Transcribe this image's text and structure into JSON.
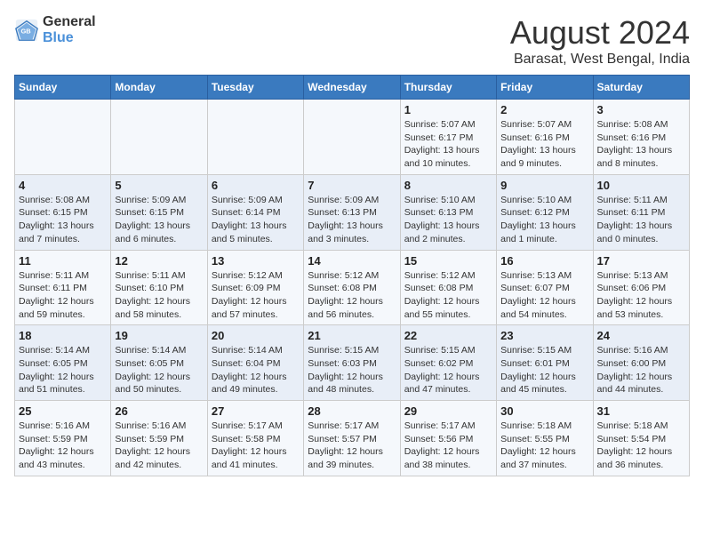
{
  "logo": {
    "line1": "General",
    "line2": "Blue"
  },
  "title": "August 2024",
  "subtitle": "Barasat, West Bengal, India",
  "days_of_week": [
    "Sunday",
    "Monday",
    "Tuesday",
    "Wednesday",
    "Thursday",
    "Friday",
    "Saturday"
  ],
  "weeks": [
    [
      {
        "day": "",
        "info": ""
      },
      {
        "day": "",
        "info": ""
      },
      {
        "day": "",
        "info": ""
      },
      {
        "day": "",
        "info": ""
      },
      {
        "day": "1",
        "info": "Sunrise: 5:07 AM\nSunset: 6:17 PM\nDaylight: 13 hours\nand 10 minutes."
      },
      {
        "day": "2",
        "info": "Sunrise: 5:07 AM\nSunset: 6:16 PM\nDaylight: 13 hours\nand 9 minutes."
      },
      {
        "day": "3",
        "info": "Sunrise: 5:08 AM\nSunset: 6:16 PM\nDaylight: 13 hours\nand 8 minutes."
      }
    ],
    [
      {
        "day": "4",
        "info": "Sunrise: 5:08 AM\nSunset: 6:15 PM\nDaylight: 13 hours\nand 7 minutes."
      },
      {
        "day": "5",
        "info": "Sunrise: 5:09 AM\nSunset: 6:15 PM\nDaylight: 13 hours\nand 6 minutes."
      },
      {
        "day": "6",
        "info": "Sunrise: 5:09 AM\nSunset: 6:14 PM\nDaylight: 13 hours\nand 5 minutes."
      },
      {
        "day": "7",
        "info": "Sunrise: 5:09 AM\nSunset: 6:13 PM\nDaylight: 13 hours\nand 3 minutes."
      },
      {
        "day": "8",
        "info": "Sunrise: 5:10 AM\nSunset: 6:13 PM\nDaylight: 13 hours\nand 2 minutes."
      },
      {
        "day": "9",
        "info": "Sunrise: 5:10 AM\nSunset: 6:12 PM\nDaylight: 13 hours\nand 1 minute."
      },
      {
        "day": "10",
        "info": "Sunrise: 5:11 AM\nSunset: 6:11 PM\nDaylight: 13 hours\nand 0 minutes."
      }
    ],
    [
      {
        "day": "11",
        "info": "Sunrise: 5:11 AM\nSunset: 6:11 PM\nDaylight: 12 hours\nand 59 minutes."
      },
      {
        "day": "12",
        "info": "Sunrise: 5:11 AM\nSunset: 6:10 PM\nDaylight: 12 hours\nand 58 minutes."
      },
      {
        "day": "13",
        "info": "Sunrise: 5:12 AM\nSunset: 6:09 PM\nDaylight: 12 hours\nand 57 minutes."
      },
      {
        "day": "14",
        "info": "Sunrise: 5:12 AM\nSunset: 6:08 PM\nDaylight: 12 hours\nand 56 minutes."
      },
      {
        "day": "15",
        "info": "Sunrise: 5:12 AM\nSunset: 6:08 PM\nDaylight: 12 hours\nand 55 minutes."
      },
      {
        "day": "16",
        "info": "Sunrise: 5:13 AM\nSunset: 6:07 PM\nDaylight: 12 hours\nand 54 minutes."
      },
      {
        "day": "17",
        "info": "Sunrise: 5:13 AM\nSunset: 6:06 PM\nDaylight: 12 hours\nand 53 minutes."
      }
    ],
    [
      {
        "day": "18",
        "info": "Sunrise: 5:14 AM\nSunset: 6:05 PM\nDaylight: 12 hours\nand 51 minutes."
      },
      {
        "day": "19",
        "info": "Sunrise: 5:14 AM\nSunset: 6:05 PM\nDaylight: 12 hours\nand 50 minutes."
      },
      {
        "day": "20",
        "info": "Sunrise: 5:14 AM\nSunset: 6:04 PM\nDaylight: 12 hours\nand 49 minutes."
      },
      {
        "day": "21",
        "info": "Sunrise: 5:15 AM\nSunset: 6:03 PM\nDaylight: 12 hours\nand 48 minutes."
      },
      {
        "day": "22",
        "info": "Sunrise: 5:15 AM\nSunset: 6:02 PM\nDaylight: 12 hours\nand 47 minutes."
      },
      {
        "day": "23",
        "info": "Sunrise: 5:15 AM\nSunset: 6:01 PM\nDaylight: 12 hours\nand 45 minutes."
      },
      {
        "day": "24",
        "info": "Sunrise: 5:16 AM\nSunset: 6:00 PM\nDaylight: 12 hours\nand 44 minutes."
      }
    ],
    [
      {
        "day": "25",
        "info": "Sunrise: 5:16 AM\nSunset: 5:59 PM\nDaylight: 12 hours\nand 43 minutes."
      },
      {
        "day": "26",
        "info": "Sunrise: 5:16 AM\nSunset: 5:59 PM\nDaylight: 12 hours\nand 42 minutes."
      },
      {
        "day": "27",
        "info": "Sunrise: 5:17 AM\nSunset: 5:58 PM\nDaylight: 12 hours\nand 41 minutes."
      },
      {
        "day": "28",
        "info": "Sunrise: 5:17 AM\nSunset: 5:57 PM\nDaylight: 12 hours\nand 39 minutes."
      },
      {
        "day": "29",
        "info": "Sunrise: 5:17 AM\nSunset: 5:56 PM\nDaylight: 12 hours\nand 38 minutes."
      },
      {
        "day": "30",
        "info": "Sunrise: 5:18 AM\nSunset: 5:55 PM\nDaylight: 12 hours\nand 37 minutes."
      },
      {
        "day": "31",
        "info": "Sunrise: 5:18 AM\nSunset: 5:54 PM\nDaylight: 12 hours\nand 36 minutes."
      }
    ]
  ]
}
